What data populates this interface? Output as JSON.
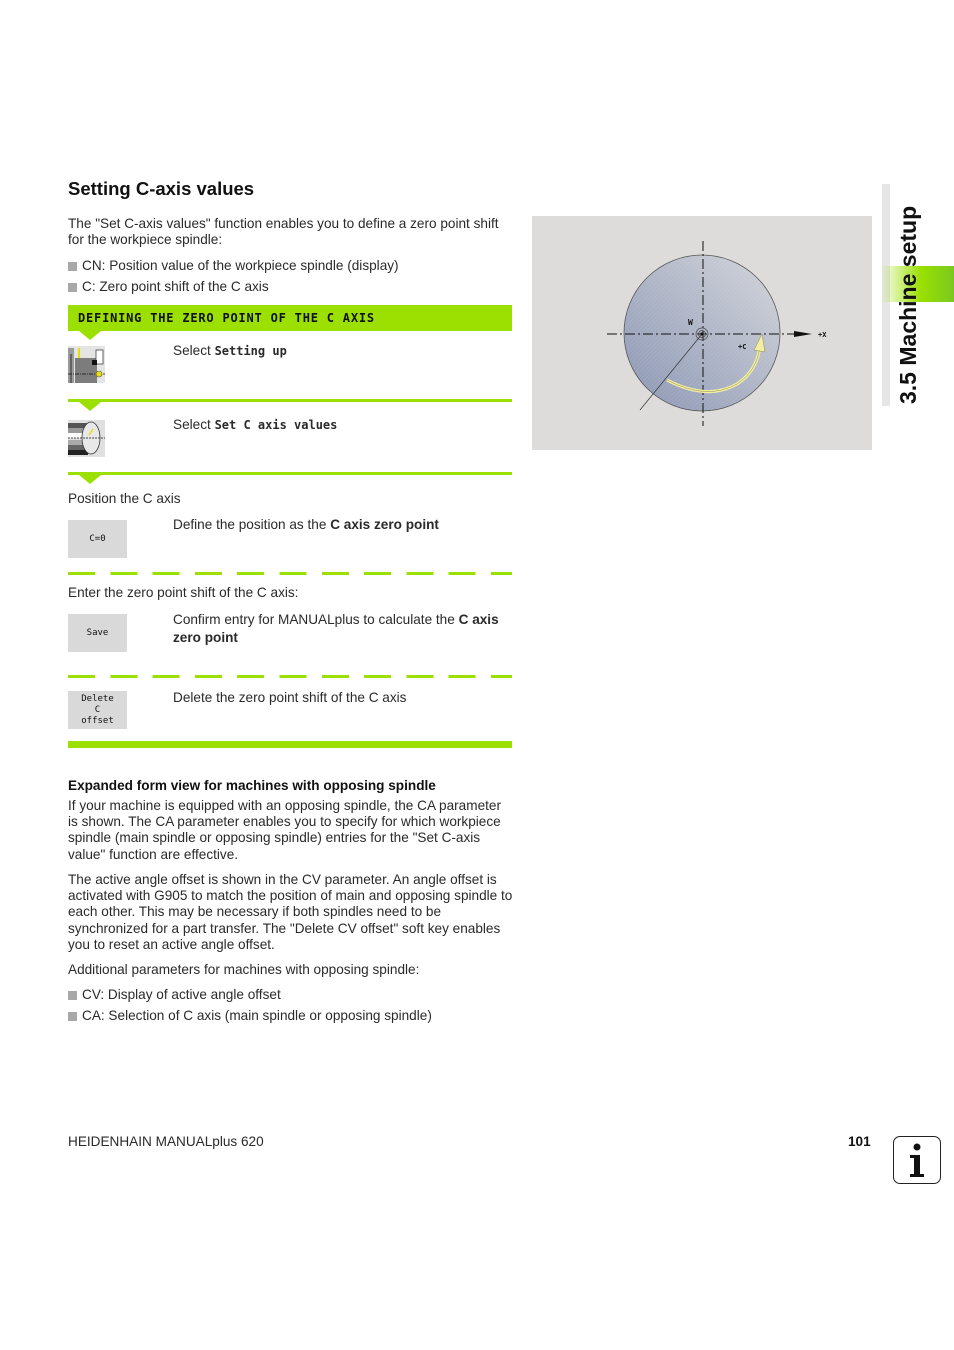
{
  "side_tab": {
    "title": "3.5 Machine setup"
  },
  "section": {
    "title": "Setting C-axis values",
    "intro": "The \"Set C-axis values\" function enables you to define a zero point shift for the workpiece spindle:",
    "bullets": [
      "CN: Position value of the workpiece spindle (display)",
      "C: Zero point shift of the C axis"
    ]
  },
  "procedure": {
    "banner": "DEFINING THE ZERO POINT OF THE C AXIS",
    "steps": [
      {
        "icon": "setting-up-icon",
        "prefix": "Select ",
        "command": "Setting up"
      },
      {
        "icon": "set-c-axis-values-icon",
        "prefix": "Select ",
        "command": "Set C axis values"
      }
    ],
    "position_label": "Position the C axis",
    "softkeys": [
      {
        "label": "C=0",
        "text_before": "Define the position as the ",
        "text_bold": "C axis zero point",
        "text_after": ""
      },
      {
        "label": "Save",
        "text_before": "Confirm entry for MANUALplus to calculate the ",
        "text_bold": "C axis zero point",
        "text_after": ""
      },
      {
        "label": "Delete C offset",
        "text_before": "Delete the zero point shift of the C axis",
        "text_bold": "",
        "text_after": ""
      }
    ],
    "enter_label": "Enter the zero point shift of the C axis:"
  },
  "figure": {
    "labels": {
      "workpiece_zero": "W",
      "c_direction": "+C",
      "x_axis": "+X"
    },
    "colors": {
      "background": "#dddcda",
      "disc": "#a9b0c4",
      "arrow": "#f3eea0"
    }
  },
  "expanded": {
    "heading": "Expanded form view for machines with opposing spindle",
    "paragraphs": [
      "If your machine is equipped with an opposing spindle, the CA parameter is shown. The CA parameter enables you to specify for which workpiece spindle (main spindle or opposing spindle) entries for the \"Set C-axis value\" function are effective.",
      "The active angle offset is shown in the CV parameter. An angle offset is activated with G905 to match the position of main and opposing spindle to each other. This may be necessary if both spindles need to be synchronized for a part transfer. The \"Delete CV offset\" soft key enables you to reset an active angle offset.",
      "Additional parameters for machines with opposing spindle:"
    ],
    "bullets": [
      "CV: Display of active angle offset",
      "CA: Selection of C axis (main spindle or opposing spindle)"
    ]
  },
  "footer": {
    "product": "HEIDENHAIN MANUALplus 620",
    "page_number": "101",
    "info_icon": "info-icon"
  },
  "colors": {
    "accent_green": "#9be000"
  }
}
